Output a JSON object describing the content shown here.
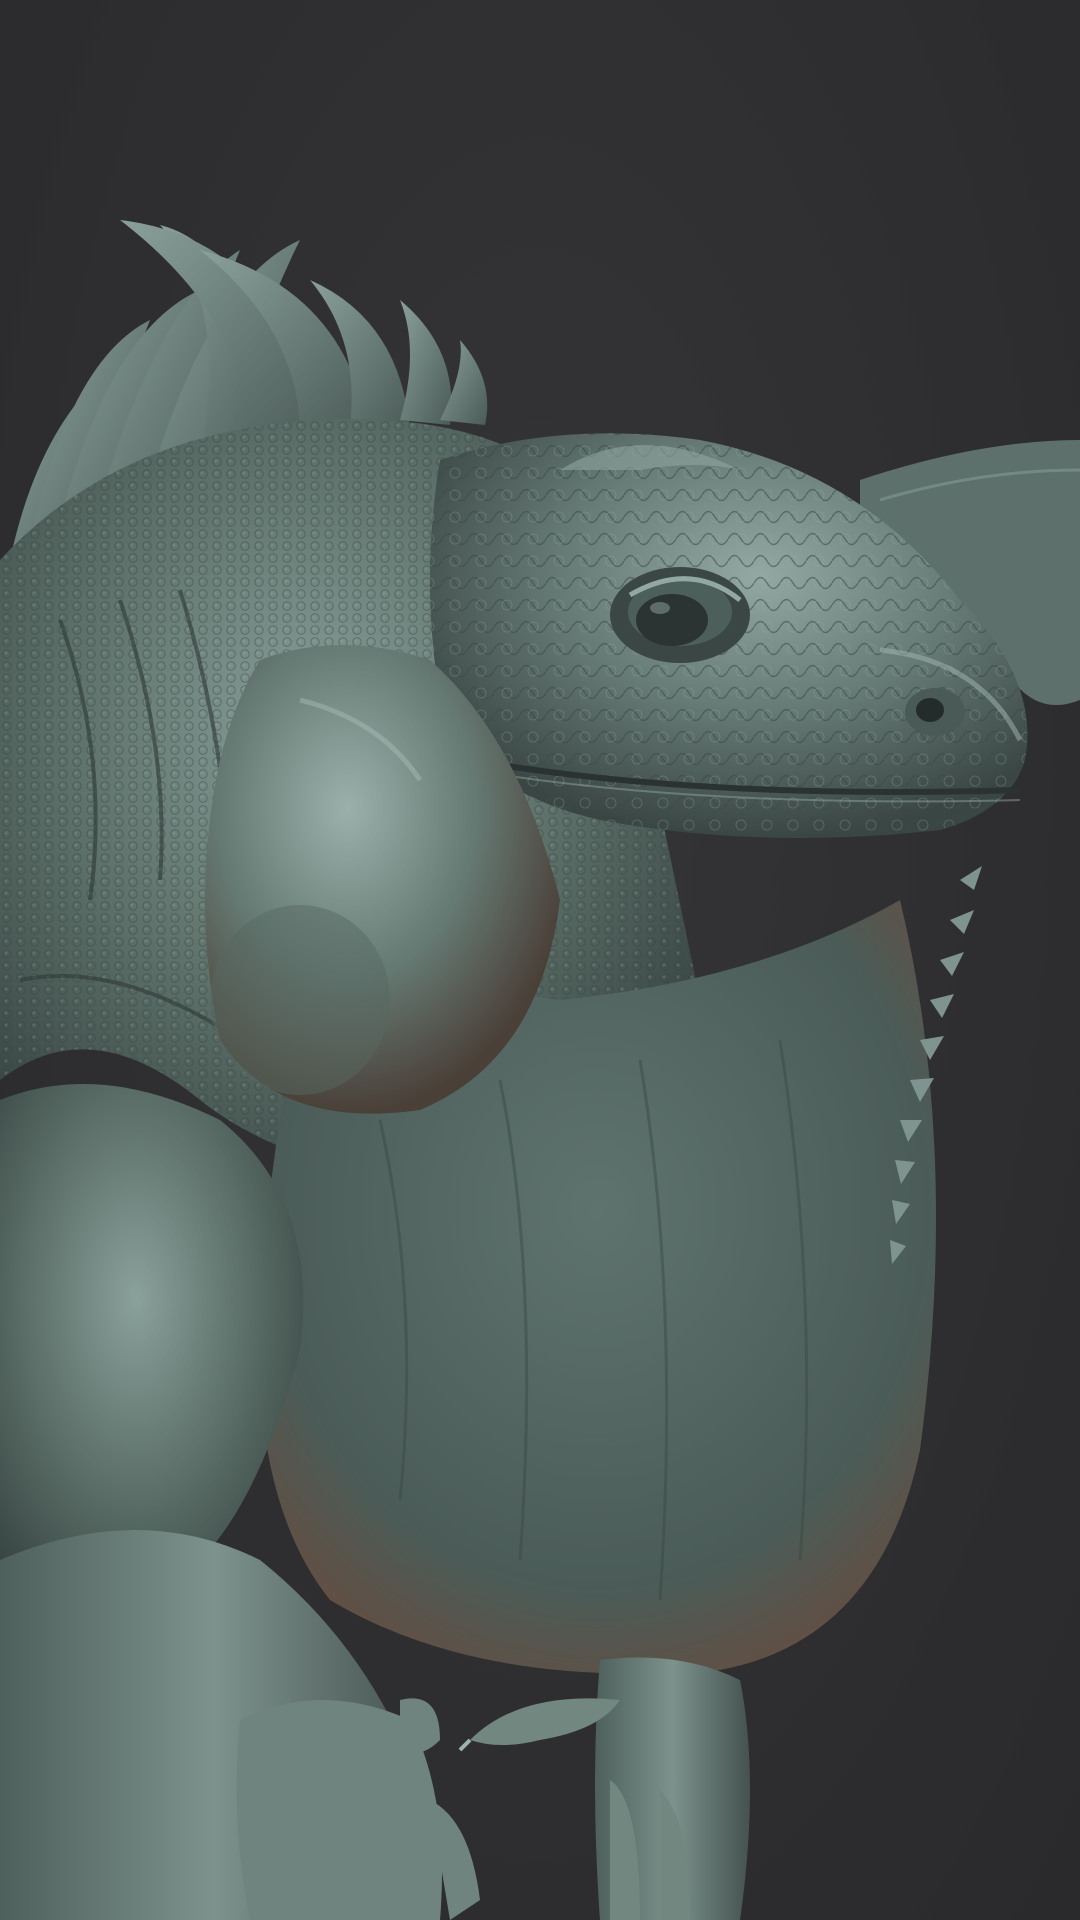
{
  "scene": {
    "subject": "iguana-sculpt",
    "background_color": "#2e2e30",
    "material": {
      "base": "#5a6e6b",
      "highlight": "#8fa5a0",
      "shadow": "#2f3a39",
      "rim": "#7a5a4a"
    }
  }
}
